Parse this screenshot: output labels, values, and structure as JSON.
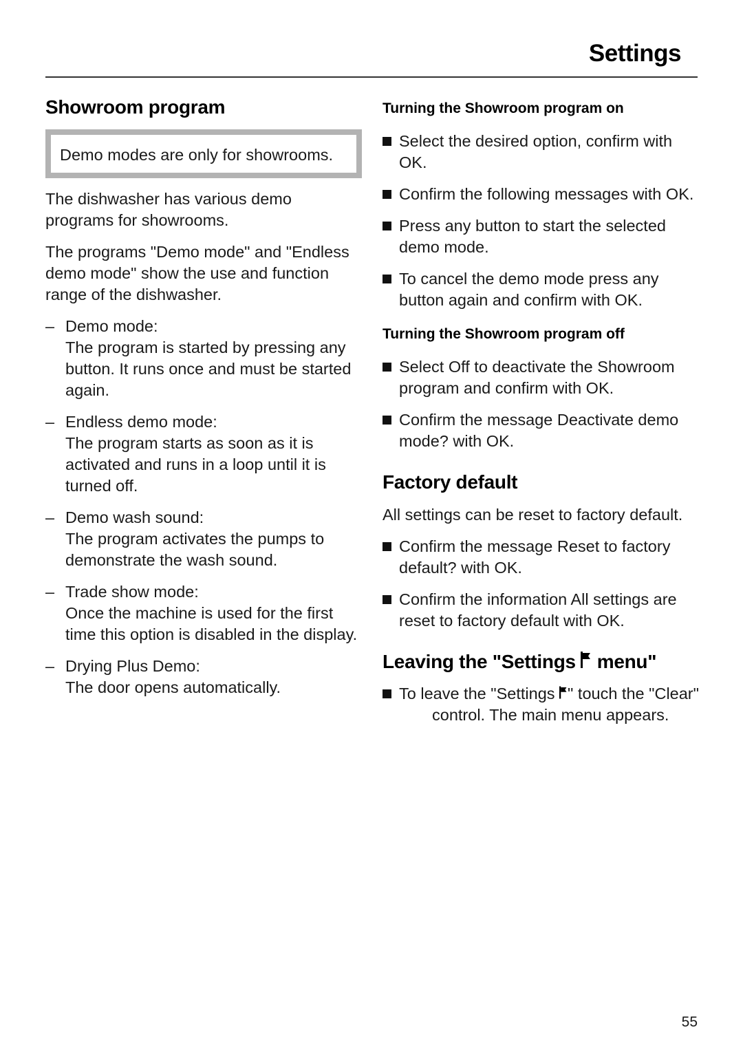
{
  "header": {
    "title": "Settings"
  },
  "showroom": {
    "heading": "Showroom program",
    "note": "Demo modes are  only for showrooms.",
    "intro": "The dishwasher has various demo programs for showrooms.",
    "description": "The programs \"Demo mode\" and \"Endless demo mode\" show the use and function range of the dishwasher.",
    "modes": [
      {
        "label": "Demo mode:",
        "text": "The program is started by pressing any button. It runs once and must be started again."
      },
      {
        "label": "Endless demo mode:",
        "text": "The program starts as soon as it is activated and runs in a loop until it is turned off."
      },
      {
        "label": "Demo wash sound:",
        "text": "The program activates the pumps to demonstrate the wash sound."
      },
      {
        "label": "Trade show mode:",
        "text": "Once the machine is used for the first time this option is disabled in the display."
      },
      {
        "label": "Drying Plus Demo:",
        "text": "The door opens automatically."
      }
    ],
    "dash": "–"
  },
  "turning_on": {
    "heading": "Turning the Showroom program on",
    "steps": [
      "Select the desired option, confirm with OK.",
      "Confirm the following messages with OK.",
      "Press any button to start the selected demo mode.",
      "To cancel the demo mode press any button again and confirm with OK."
    ]
  },
  "turning_off": {
    "heading": "Turning the Showroom program off",
    "steps": [
      "Select Off to deactivate the Showroom program and confirm with OK.",
      "Confirm the message Deactivate demo mode? with OK."
    ]
  },
  "factory_default": {
    "heading": "Factory default",
    "intro": "All settings can be reset to factory default.",
    "steps": [
      "Confirm the message Reset to factory default? with OK.",
      "Confirm the information All settings are reset to factory default with OK."
    ]
  },
  "leaving": {
    "heading_before": "Leaving the \"Settings ",
    "heading_after": " menu\"",
    "step_part1": "To leave the \"Settings ",
    "step_part2": "\" touch the \"Clear\"",
    "step_part3": "control. The main menu appears.",
    "icon": "settings-flag-icon"
  },
  "footer": {
    "page_number": "55"
  }
}
